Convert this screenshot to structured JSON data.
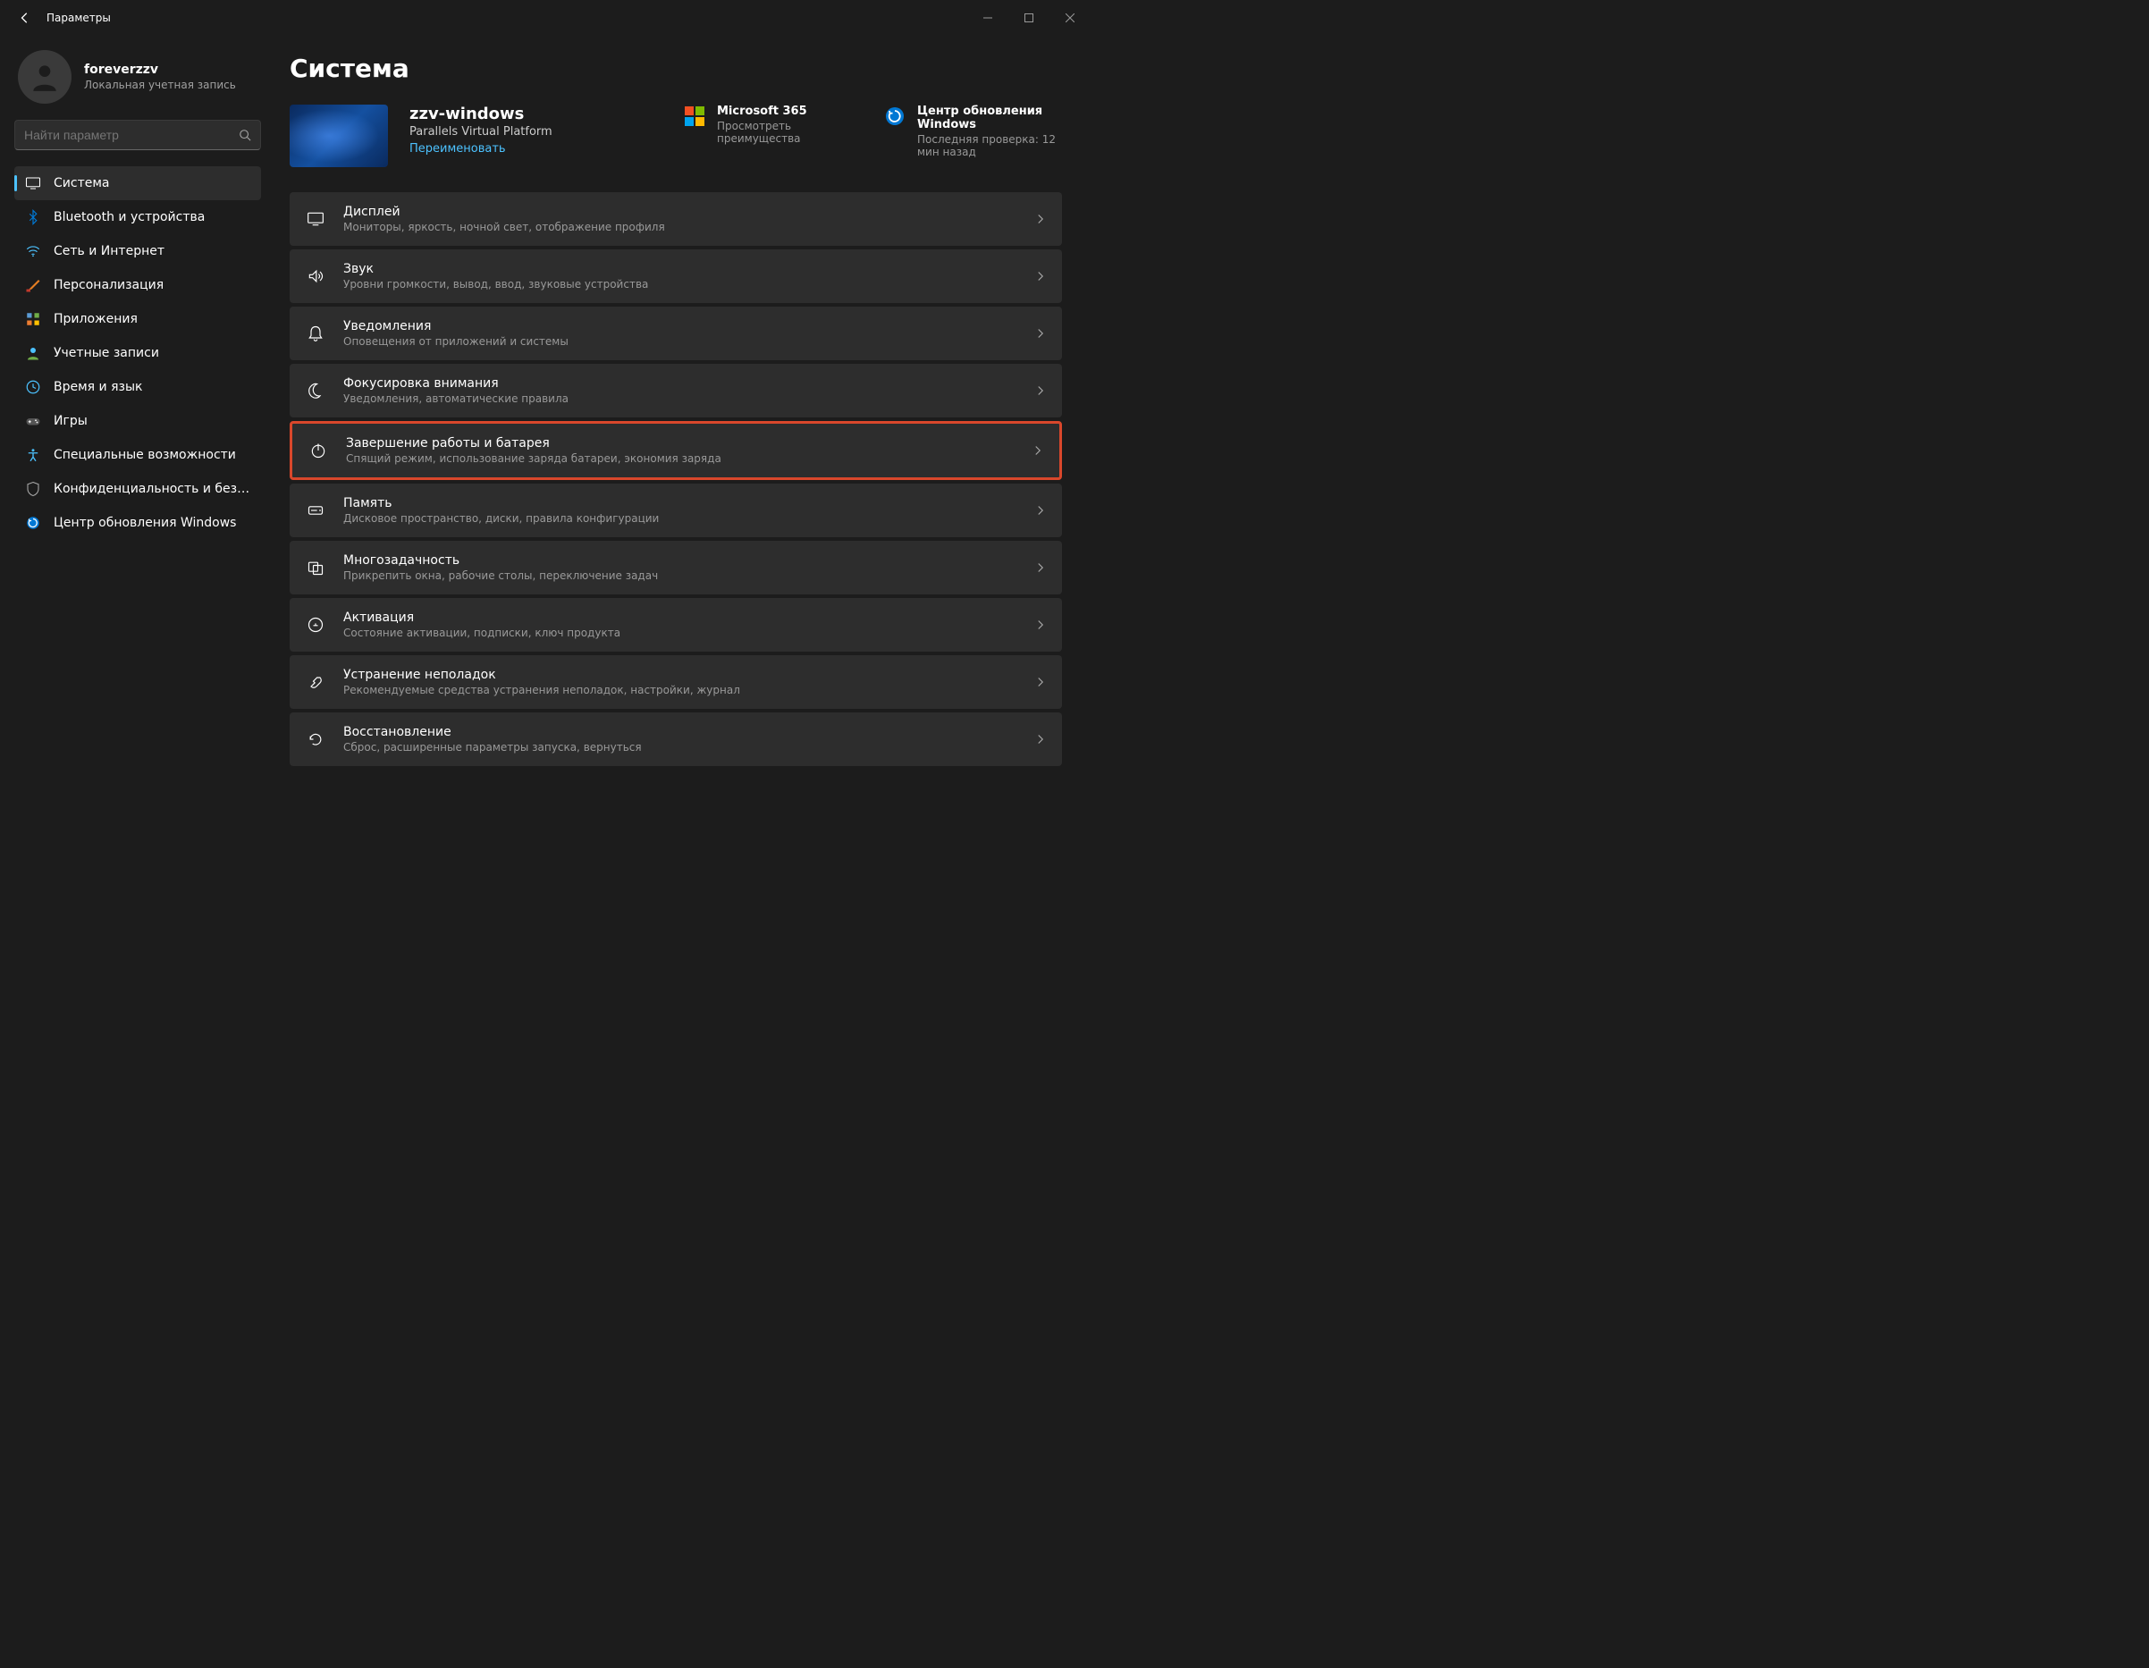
{
  "window": {
    "title": "Параметры"
  },
  "profile": {
    "name": "foreverzzv",
    "subtitle": "Локальная учетная запись"
  },
  "search": {
    "placeholder": "Найти параметр"
  },
  "nav": [
    {
      "label": "Система",
      "icon": "display"
    },
    {
      "label": "Bluetooth и устройства",
      "icon": "bluetooth"
    },
    {
      "label": "Сеть и Интернет",
      "icon": "wifi"
    },
    {
      "label": "Персонализация",
      "icon": "brush"
    },
    {
      "label": "Приложения",
      "icon": "apps"
    },
    {
      "label": "Учетные записи",
      "icon": "person"
    },
    {
      "label": "Время и язык",
      "icon": "clock"
    },
    {
      "label": "Игры",
      "icon": "game"
    },
    {
      "label": "Специальные возможности",
      "icon": "accessibility"
    },
    {
      "label": "Конфиденциальность и безопасность",
      "icon": "shield"
    },
    {
      "label": "Центр обновления Windows",
      "icon": "update"
    }
  ],
  "page": {
    "title": "Система"
  },
  "device": {
    "name": "zzv-windows",
    "platform": "Parallels Virtual Platform",
    "rename": "Переименовать"
  },
  "cards": {
    "ms365": {
      "title": "Microsoft 365",
      "sub": "Просмотреть преимущества"
    },
    "wu": {
      "title": "Центр обновления Windows",
      "sub": "Последняя проверка: 12 мин назад"
    }
  },
  "settings": [
    {
      "icon": "display",
      "title": "Дисплей",
      "sub": "Мониторы, яркость, ночной свет, отображение профиля"
    },
    {
      "icon": "sound",
      "title": "Звук",
      "sub": "Уровни громкости, вывод, ввод, звуковые устройства"
    },
    {
      "icon": "bell",
      "title": "Уведомления",
      "sub": "Оповещения от приложений и системы"
    },
    {
      "icon": "moon",
      "title": "Фокусировка внимания",
      "sub": "Уведомления, автоматические правила"
    },
    {
      "icon": "power",
      "title": "Завершение работы и батарея",
      "sub": "Спящий режим, использование заряда батареи, экономия заряда",
      "highlighted": true
    },
    {
      "icon": "storage",
      "title": "Память",
      "sub": "Дисковое пространство, диски, правила конфигурации"
    },
    {
      "icon": "multitask",
      "title": "Многозадачность",
      "sub": "Прикрепить окна, рабочие столы, переключение задач"
    },
    {
      "icon": "key",
      "title": "Активация",
      "sub": "Состояние активации, подписки, ключ продукта"
    },
    {
      "icon": "wrench",
      "title": "Устранение неполадок",
      "sub": "Рекомендуемые средства устранения неполадок, настройки, журнал"
    },
    {
      "icon": "recover",
      "title": "Восстановление",
      "sub": "Сброс, расширенные параметры запуска, вернуться"
    }
  ]
}
